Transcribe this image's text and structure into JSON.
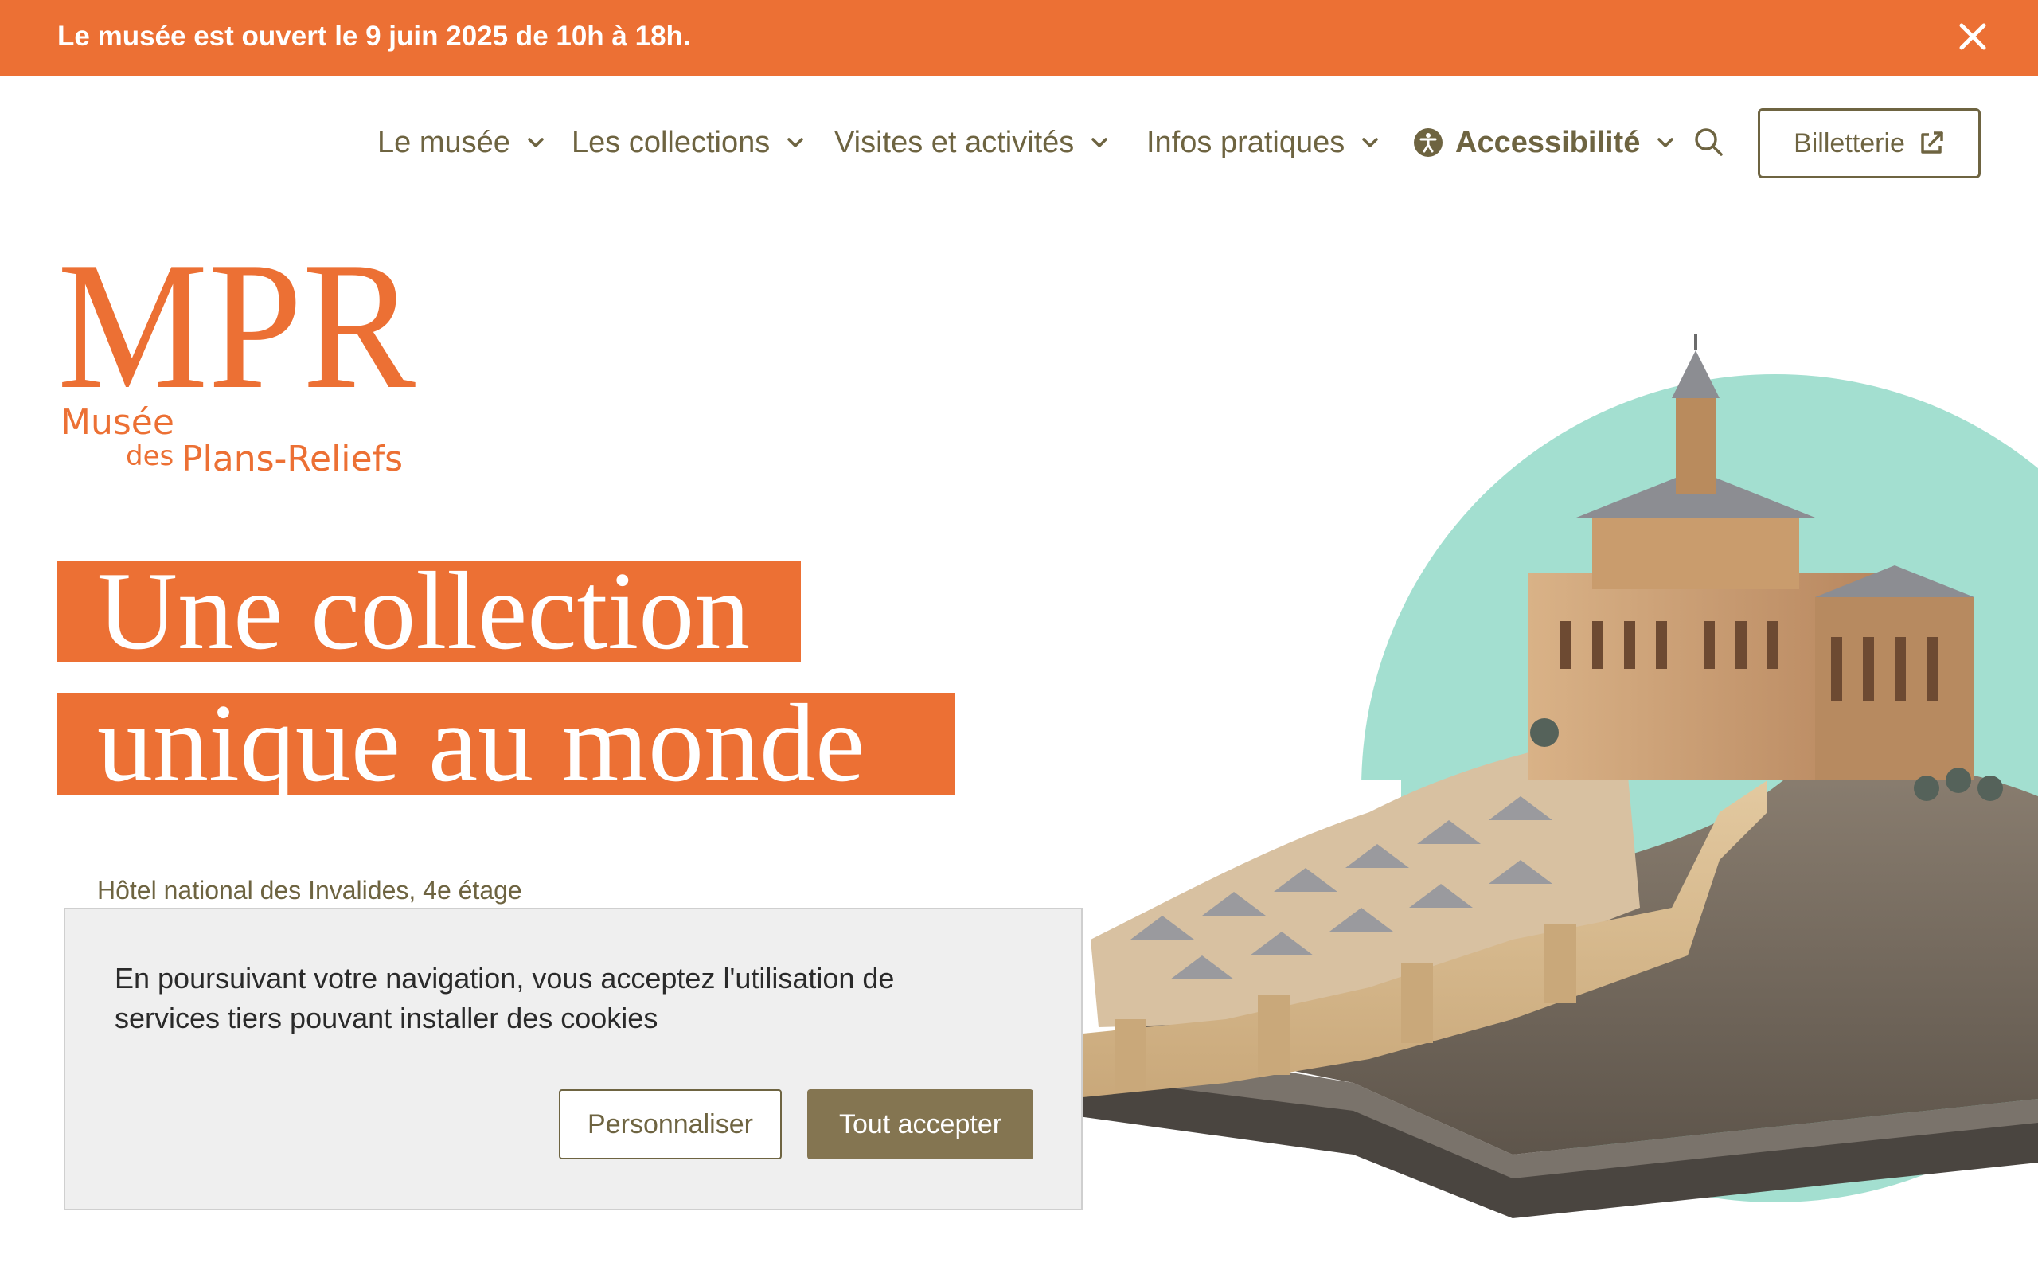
{
  "banner": {
    "message": "Le musée est ouvert le 9 juin 2025 de 10h à 18h.",
    "close_icon": "close-icon"
  },
  "nav": {
    "items": [
      {
        "label": "Le musée"
      },
      {
        "label": "Les collections"
      },
      {
        "label": "Visites et activités"
      },
      {
        "label": "Infos pratiques"
      },
      {
        "label": "Accessibilité"
      }
    ],
    "search_icon": "search-icon",
    "ticket_label": "Billetterie",
    "ticket_icon": "external-link-icon"
  },
  "logo": {
    "monogram": "MPR",
    "line1": "Musée",
    "line2": "des",
    "line3": "Plans-Reliefs"
  },
  "hero": {
    "line1": "Une collection",
    "line2": "unique au monde",
    "address": "Hôtel national des Invalides, 4e étage"
  },
  "cookie": {
    "text": "En poursuivant votre navigation, vous acceptez l'utilisation de services tiers pouvant installer des cookies",
    "customize_label": "Personnaliser",
    "accept_label": "Tout accepter"
  },
  "colors": {
    "accent_orange": "#ec7034",
    "text_olive": "#6e6441",
    "button_olive": "#847551",
    "mint_circle": "#a3dfd0"
  }
}
